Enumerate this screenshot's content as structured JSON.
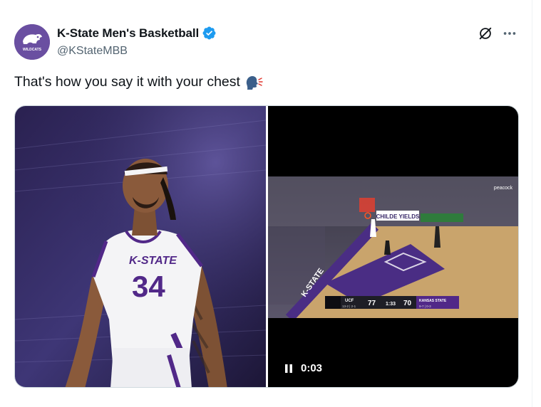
{
  "author": {
    "display_name": "K-State Men's Basketball",
    "handle": "@KStateMBB",
    "verified": true,
    "avatar_icon": "wildcat-logo-icon",
    "avatar_caption": "WILDCATS",
    "avatar_color": "#512888"
  },
  "actions": {
    "grok_icon": "grok-icon",
    "more_icon": "more-icon"
  },
  "tweet": {
    "text": "That's how you say it with your chest",
    "emoji": "speaking-head-emoji"
  },
  "media": {
    "photo": {
      "jersey_team": "K-STATE",
      "jersey_number": "34"
    },
    "video": {
      "timestamp": "0:03",
      "state": "playing",
      "broadcast_logo": "peacock",
      "courtside_ad": "CHILDE YIELDS",
      "scoreboard": {
        "home_team": "UCF",
        "home_record": "13-2 | 2-1",
        "home_score": "77",
        "clock": "1:33",
        "away_team": "KANSAS STATE",
        "away_record": "9-7 | 0-3",
        "away_score": "70"
      }
    }
  },
  "colors": {
    "verified_blue": "#1d9bf0",
    "kstate_purple": "#512888",
    "text_primary": "#0f1419",
    "text_secondary": "#536471"
  }
}
